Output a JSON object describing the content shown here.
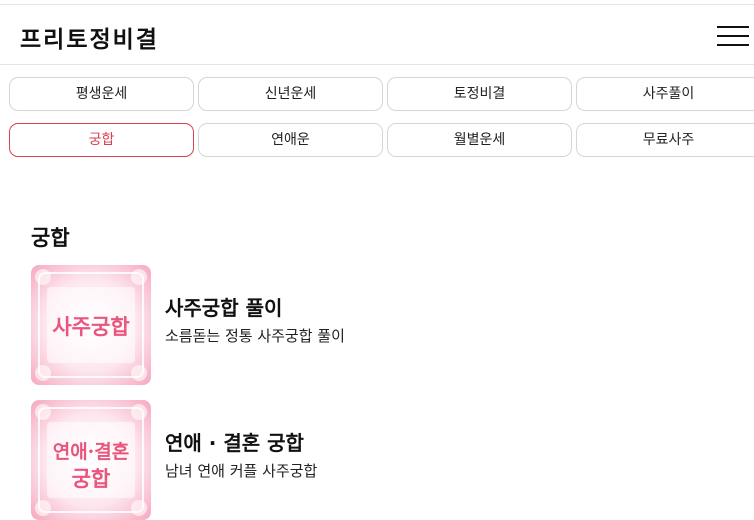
{
  "header": {
    "logo": "프리토정비결",
    "menu_icon": "hamburger-menu-icon"
  },
  "tabs": [
    {
      "label": "평생운세"
    },
    {
      "label": "신년운세"
    },
    {
      "label": "토정비결"
    },
    {
      "label": "사주풀이"
    },
    {
      "label": "궁합",
      "active": true
    },
    {
      "label": "연애운"
    },
    {
      "label": "월별운세"
    },
    {
      "label": "무료사주"
    }
  ],
  "section": {
    "title": "궁합",
    "items": [
      {
        "title": "사주궁합 풀이",
        "desc": "소름돋는 정통 사주궁합 풀이",
        "thumb_text": "사주궁합"
      },
      {
        "title": "연애 · 결혼 궁합",
        "desc": "남녀 연애 커플 사주궁합",
        "thumb_line1": "연애·결혼",
        "thumb_line2": "궁합"
      }
    ]
  },
  "colors": {
    "accent": "#d9414f",
    "thumb_pink": "#f7b3c6",
    "thumb_text": "#e8557d"
  }
}
